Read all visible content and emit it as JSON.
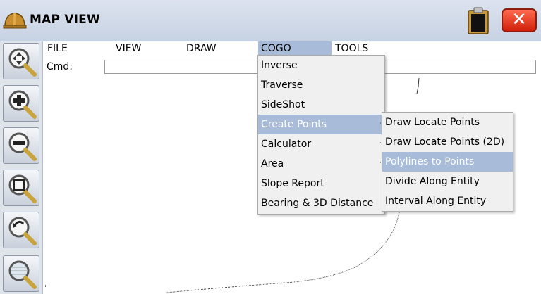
{
  "window": {
    "title": "MAP VIEW"
  },
  "menubar": {
    "items": [
      "FILE",
      "VIEW",
      "DRAW",
      "COGO",
      "TOOLS"
    ],
    "active": "COGO"
  },
  "command": {
    "label": "Cmd:",
    "value": ""
  },
  "cogo_menu": {
    "items": [
      "Inverse",
      "Traverse",
      "SideShot",
      "Create Points",
      "Calculator",
      "Area",
      "Slope Report",
      "Bearing & 3D Distance"
    ],
    "highlighted": "Create Points"
  },
  "create_points_submenu": {
    "items": [
      "Draw Locate Points",
      "Draw Locate Points (2D)",
      "Polylines to Points",
      "Divide Along Entity",
      "Interval Along Entity"
    ],
    "highlighted": "Polylines to Points"
  },
  "toolbar": {
    "icons": [
      "zoom-pan-icon",
      "zoom-in-icon",
      "zoom-out-icon",
      "zoom-window-icon",
      "zoom-previous-icon",
      "zoom-extents-icon"
    ]
  },
  "canvas": {
    "origin_marker": "ˈ"
  },
  "colors": {
    "highlight": "#a8bcd9",
    "close_button": "#e0341a",
    "titlebar": "#cfd8e7"
  }
}
